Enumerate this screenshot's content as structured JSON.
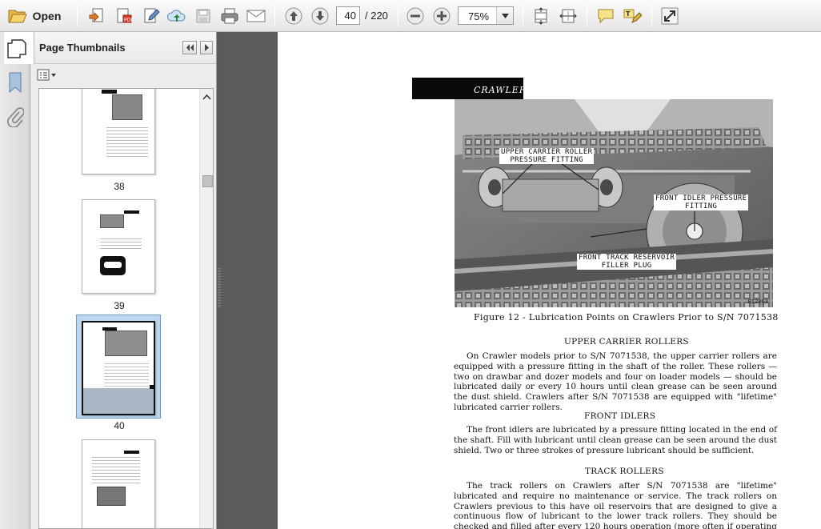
{
  "toolbar": {
    "open_label": "Open",
    "current_page": "40",
    "page_total": "/ 220",
    "zoom": "75%",
    "icons": [
      "folder-open-icon",
      "create-icon",
      "convert-icon",
      "edit-icon",
      "upload-icon",
      "save-icon",
      "print-icon",
      "email-icon",
      "prev-page-icon",
      "next-page-icon",
      "zoom-out-icon",
      "zoom-in-icon",
      "fit-page-icon",
      "fit-width-icon",
      "comment-icon",
      "highlight-icon",
      "fullscreen-icon"
    ]
  },
  "sidebar": {
    "title": "Page Thumbnails",
    "thumbnails": [
      {
        "label": "38"
      },
      {
        "label": "39"
      },
      {
        "label": "40",
        "selected": true
      },
      {
        "label": ""
      }
    ]
  },
  "document": {
    "header_text": "CRAWLER",
    "figure": {
      "callouts": {
        "upper_carrier": "UPPER CARRIER ROLLER\nPRESSURE FITTING",
        "front_idler": "FRONT IDLER PRESSURE\nFITTING",
        "front_track": "FRONT TRACK RESERVOIR\nFILLER PLUG"
      },
      "code": "BI2063",
      "caption": "Figure 12 - Lubrication Points on Crawlers Prior to S/N 7071538"
    },
    "sections": [
      {
        "title": "UPPER CARRIER ROLLERS",
        "text": "On Crawler models prior to S/N 7071538, the upper carrier rollers are equipped with a pressure fitting in the shaft of the roller. These rollers — two on drawbar and dozer models and four on loader models — should be lubricated daily or every 10 hours until clean grease can be seen around the dust shield. Crawlers after S/N 7071538 are equipped with \"lifetime\" lubricated carrier rollers."
      },
      {
        "title": "FRONT IDLERS",
        "text": "The front idlers are lubricated by a pressure fitting located in the end of the shaft. Fill with lubricant until clean grease can be seen around the dust shield. Two or three strokes of pressure lubricant should be sufficient."
      },
      {
        "title": "TRACK ROLLERS",
        "text": "The track rollers on Crawlers after S/N 7071538 are \"lifetime\" lubricated and require no maintenance or service. The track rollers on Crawlers previous to this have oil reservoirs that are designed to give a continuous flow of lubricant to the lower track rollers. They should be checked and filled after every 120 hours operation (more often if operating in water or mud)."
      }
    ]
  }
}
